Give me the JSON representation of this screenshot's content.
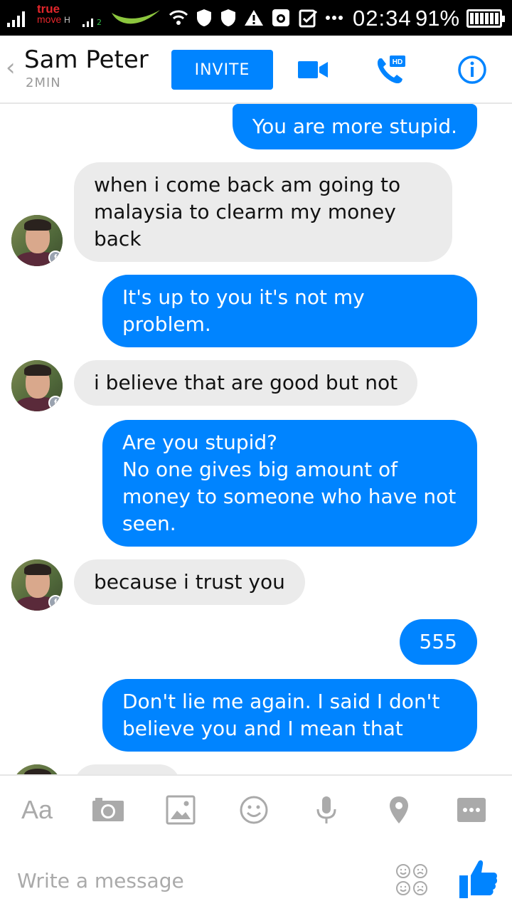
{
  "status_bar": {
    "carrier_line1": "true",
    "carrier_line2": "move",
    "network_type": "H",
    "sim2_label": "2",
    "time": "02:34",
    "battery": "91%"
  },
  "header": {
    "back_icon": "chevron-left-icon",
    "contact_name": "Sam Peter",
    "contact_status": "2MIN",
    "invite_label": "INVITE",
    "video_icon": "video-camera-icon",
    "call_icon": "phone-hd-icon",
    "call_badge": "HD",
    "info_icon": "info-icon",
    "accent_color": "#0084ff"
  },
  "messages": [
    {
      "direction": "out",
      "text": "You are more stupid."
    },
    {
      "direction": "in",
      "text": "when i come back am going to malaysia to clearm my money back"
    },
    {
      "direction": "out",
      "text": "It's up to you it's not my problem."
    },
    {
      "direction": "in",
      "text": "i believe that are good but not"
    },
    {
      "direction": "out",
      "text": "Are you stupid?\nNo one gives big amount of money to someone who have not seen."
    },
    {
      "direction": "in",
      "text": "because i trust you"
    },
    {
      "direction": "out",
      "text": "555"
    },
    {
      "direction": "out",
      "text": "Don't lie me again. I said I don't believe you  and I mean that"
    }
  ],
  "composer": {
    "font_button": "Aa",
    "tools": [
      "text-format-icon",
      "camera-icon",
      "gallery-icon",
      "emoji-icon",
      "microphone-icon",
      "location-icon",
      "more-icon"
    ],
    "placeholder": "Write a message",
    "sticker_icon": "sticker-icon",
    "like_icon": "thumbs-up-icon"
  }
}
